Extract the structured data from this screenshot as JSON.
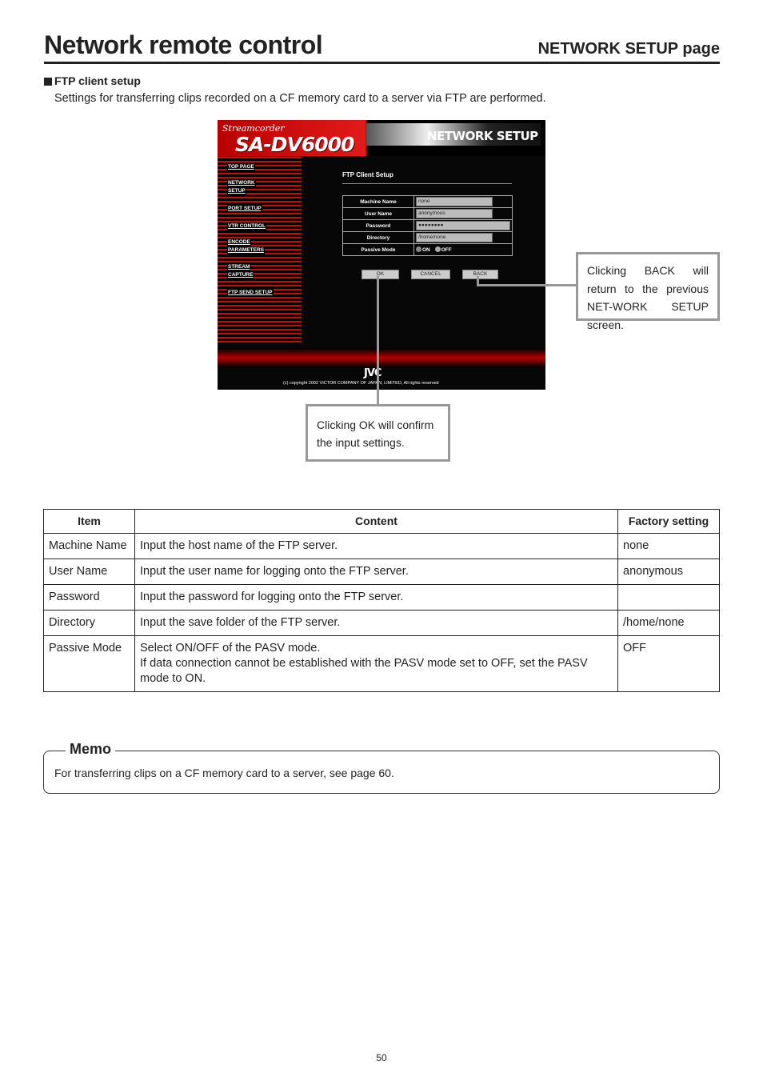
{
  "header": {
    "title": "Network remote control",
    "subtitle": "NETWORK SETUP page"
  },
  "section": {
    "heading": "FTP client setup",
    "description": "Settings for transferring clips recorded on a CF memory card to a server via FTP are performed."
  },
  "screenshot": {
    "brand_small": "Streamcorder",
    "brand_big": "SA-DV6000",
    "page_title": "NETWORK SETUP",
    "nav": [
      "TOP PAGE",
      "NETWORK",
      "SETUP",
      "PORT SETUP",
      "VTR CONTROL",
      "ENCODE",
      "PARAMETERS",
      "STREAM",
      "CAPTURE",
      "FTP SEND SETUP"
    ],
    "form_title": "FTP Client Setup",
    "fields": [
      {
        "label": "Machine Name",
        "value": "none"
      },
      {
        "label": "User Name",
        "value": "anonymous"
      },
      {
        "label": "Password",
        "value": "●●●●●●●●"
      },
      {
        "label": "Directory",
        "value": "/home/none"
      }
    ],
    "passive_label": "Passive Mode",
    "radio_on": "ON",
    "radio_off": "OFF",
    "buttons": {
      "ok": "OK",
      "cancel": "CANCEL",
      "back": "BACK"
    },
    "logo": "JVC",
    "copyright": "(c) copyright 2002 VICTOR COMPANY OF JAPAN, LIMITED, All rights reserved"
  },
  "callouts": {
    "back": "Clicking BACK will return to the previous NET-WORK SETUP screen.",
    "ok": "Clicking OK will confirm the input settings."
  },
  "table": {
    "headers": [
      "Item",
      "Content",
      "Factory setting"
    ],
    "rows": [
      {
        "item": "Machine Name",
        "content": "Input the host name of the FTP server.",
        "content2": "",
        "setting": "none"
      },
      {
        "item": "User Name",
        "content": "Input the user name for logging onto the FTP server.",
        "content2": "",
        "setting": "anonymous"
      },
      {
        "item": "Password",
        "content": "Input the password for logging onto the FTP server.",
        "content2": "",
        "setting": ""
      },
      {
        "item": "Directory",
        "content": "Input the save folder of the FTP server.",
        "content2": "",
        "setting": "/home/none"
      },
      {
        "item": "Passive Mode",
        "content": "Select ON/OFF of the PASV mode.",
        "content2": "If data connection cannot be established with the PASV mode set to OFF, set the PASV mode to ON.",
        "setting": "OFF"
      }
    ]
  },
  "memo": {
    "label": "Memo",
    "text": "For transferring clips on a CF memory card to a server, see page 60."
  },
  "page_number": "50"
}
